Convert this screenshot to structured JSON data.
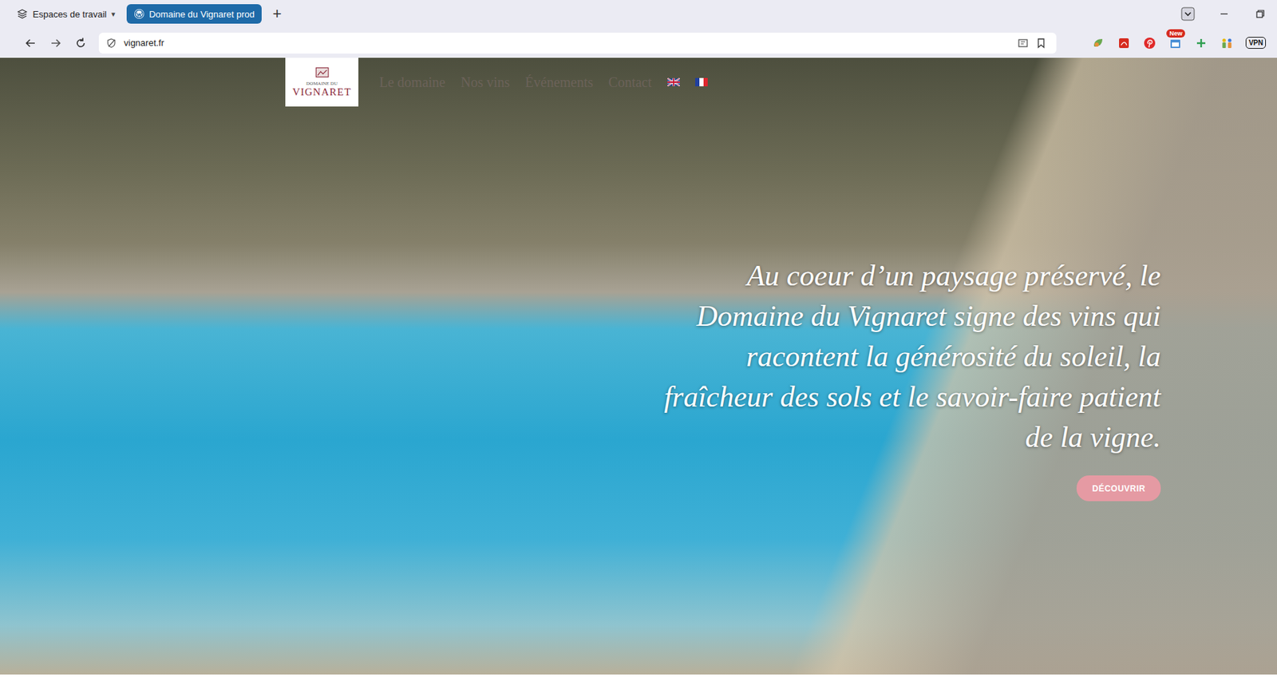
{
  "browser": {
    "workspaces": {
      "label": "Espaces de travail",
      "caret": "▾"
    },
    "tabs": [
      {
        "label": "Domaine du Vignaret prod",
        "selected": true
      }
    ],
    "new_tab": "+",
    "address": "vignaret.fr",
    "extension_badge": "New",
    "vpn": "VPN"
  },
  "site": {
    "logo": {
      "top": "DOMAINE DU",
      "name": "VIGNARET"
    },
    "nav": [
      {
        "label": "Le domaine"
      },
      {
        "label": "Nos vins"
      },
      {
        "label": "Événements"
      },
      {
        "label": "Contact"
      }
    ],
    "headline": [
      "Au coeur d’un paysage préservé, le",
      "Domaine du Vignaret signe des vins qui",
      "racontent la générosité du soleil, la",
      "fraîcheur des sols et le savoir-faire patient",
      "de la vigne."
    ],
    "button": "DÉCOUVRIR"
  }
}
